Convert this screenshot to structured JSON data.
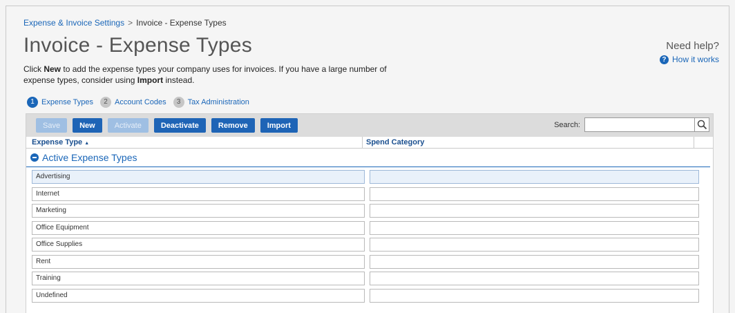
{
  "breadcrumb": {
    "parent": "Expense & Invoice Settings",
    "separator": ">",
    "current": "Invoice - Expense Types"
  },
  "page_title": "Invoice - Expense Types",
  "description": {
    "part1": "Click ",
    "new_word": "New",
    "part2": " to add the expense types your company uses for invoices. If you have a large number of expense types, consider using ",
    "import_word": "Import",
    "part3": " instead."
  },
  "help": {
    "need_help": "Need help?",
    "how_it_works": "How it works"
  },
  "steps": [
    {
      "num": "1",
      "label": "Expense Types",
      "active": true
    },
    {
      "num": "2",
      "label": "Account Codes",
      "active": false
    },
    {
      "num": "3",
      "label": "Tax Administration",
      "active": false
    }
  ],
  "toolbar": {
    "save": "Save",
    "new": "New",
    "activate": "Activate",
    "deactivate": "Deactivate",
    "remove": "Remove",
    "import": "Import",
    "search_label": "Search:",
    "search_value": ""
  },
  "table": {
    "col_expense_type": "Expense Type",
    "sort_indicator": "▲",
    "col_spend_category": "Spend Category",
    "group_label": "Active Expense Types",
    "rows": [
      {
        "expense_type": "Advertising",
        "spend_category": "",
        "selected": true
      },
      {
        "expense_type": "Internet",
        "spend_category": ""
      },
      {
        "expense_type": "Marketing",
        "spend_category": ""
      },
      {
        "expense_type": "Office Equipment",
        "spend_category": ""
      },
      {
        "expense_type": "Office Supplies",
        "spend_category": ""
      },
      {
        "expense_type": "Rent",
        "spend_category": ""
      },
      {
        "expense_type": "Training",
        "spend_category": ""
      },
      {
        "expense_type": "Undefined",
        "spend_category": ""
      }
    ]
  },
  "colors": {
    "accent": "#1a66b8",
    "button": "#1e64b6",
    "button_disabled": "#9fbfe3"
  }
}
